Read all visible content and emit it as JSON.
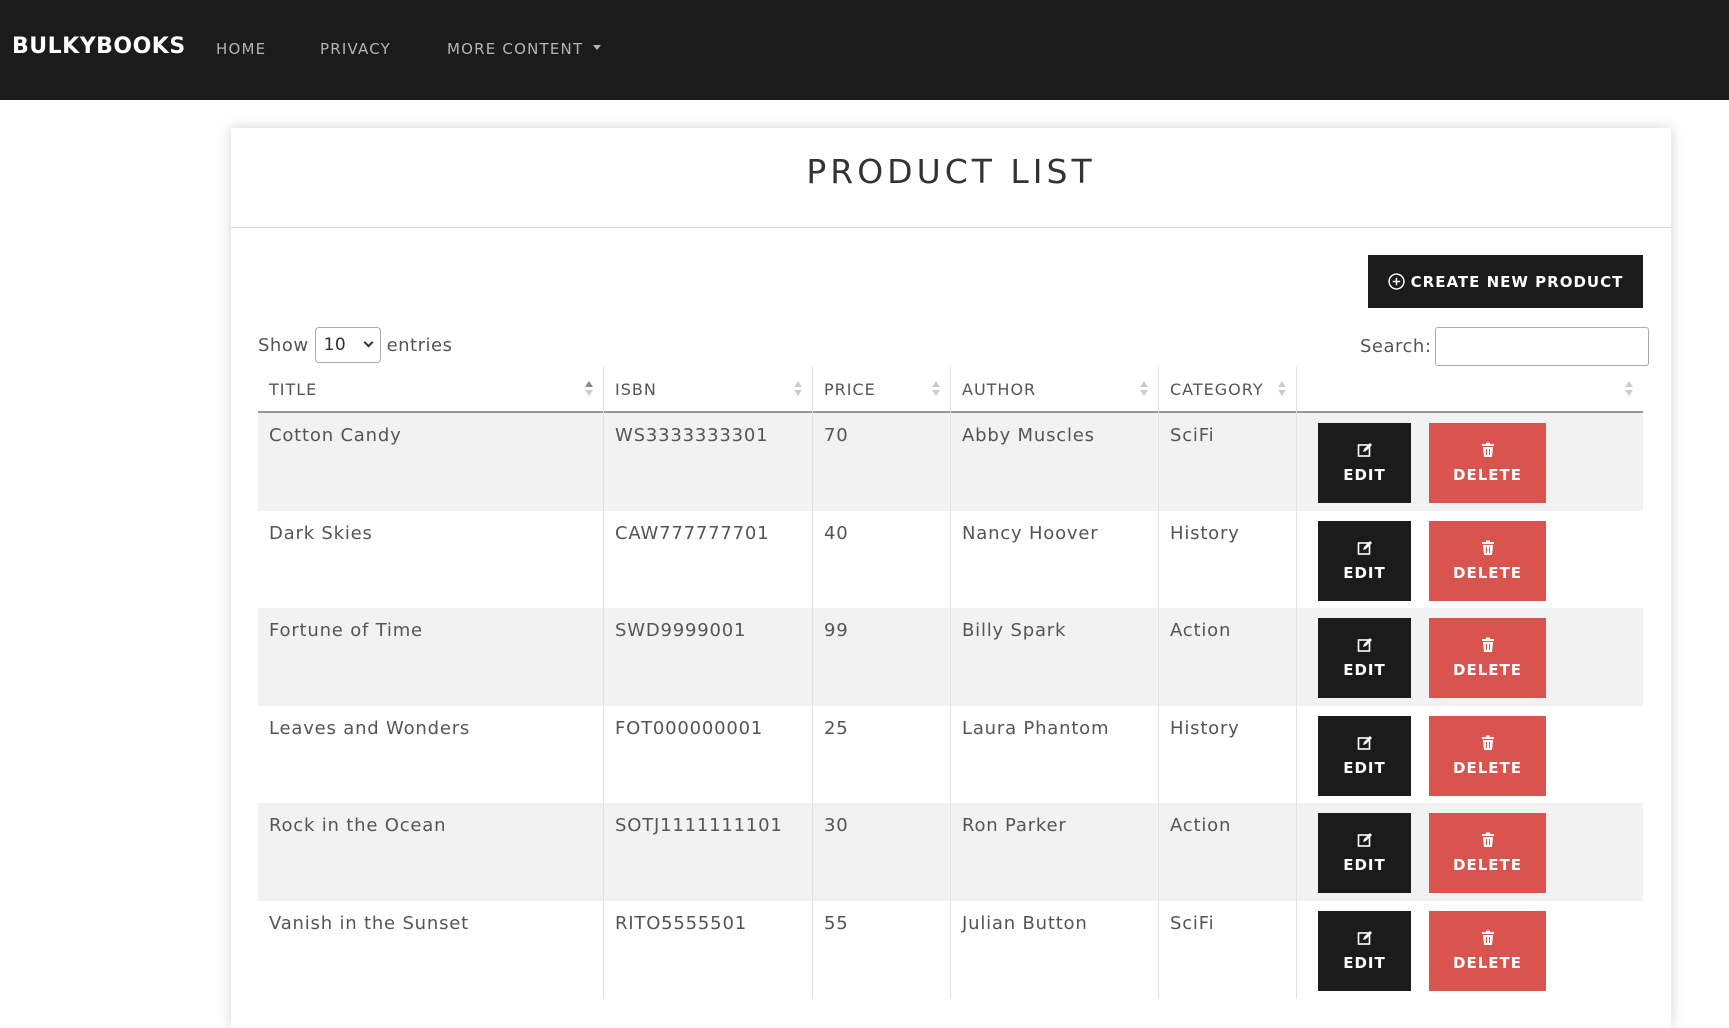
{
  "navbar": {
    "brand": "BULKYBOOKS",
    "links": [
      {
        "label": "HOME"
      },
      {
        "label": "PRIVACY"
      },
      {
        "label": "MORE CONTENT"
      }
    ]
  },
  "page": {
    "title": "PRODUCT LIST",
    "create_label": "CREATE NEW PRODUCT",
    "show_label": "Show",
    "entries_label": "entries",
    "page_size": "10",
    "search_label": "Search:",
    "search_value": ""
  },
  "table": {
    "columns": [
      "TITLE",
      "ISBN",
      "PRICE",
      "AUTHOR",
      "CATEGORY",
      ""
    ],
    "sorted_column": "TITLE",
    "sort_direction": "ascending",
    "edit_label": "EDIT",
    "delete_label": "DELETE",
    "rows": [
      {
        "title": "Cotton Candy",
        "isbn": "WS3333333301",
        "price": "70",
        "author": "Abby Muscles",
        "category": "SciFi"
      },
      {
        "title": "Dark Skies",
        "isbn": "CAW777777701",
        "price": "40",
        "author": "Nancy Hoover",
        "category": "History"
      },
      {
        "title": "Fortune of Time",
        "isbn": "SWD9999001",
        "price": "99",
        "author": "Billy Spark",
        "category": "Action"
      },
      {
        "title": "Leaves and Wonders",
        "isbn": "FOT000000001",
        "price": "25",
        "author": "Laura Phantom",
        "category": "History"
      },
      {
        "title": "Rock in the Ocean",
        "isbn": "SOTJ1111111101",
        "price": "30",
        "author": "Ron Parker",
        "category": "Action"
      },
      {
        "title": "Vanish in the Sunset",
        "isbn": "RITO5555501",
        "price": "55",
        "author": "Julian Button",
        "category": "SciFi"
      }
    ]
  },
  "colors": {
    "navbar_bg": "#1b1b1b",
    "primary_button": "#1b1b1b",
    "danger_button": "#d9534f",
    "stripe_row": "#f2f2f2"
  },
  "icons": {
    "create": "plus-circle-icon",
    "edit": "edit-icon",
    "delete": "trash-icon",
    "dropdown": "caret-down-icon"
  }
}
